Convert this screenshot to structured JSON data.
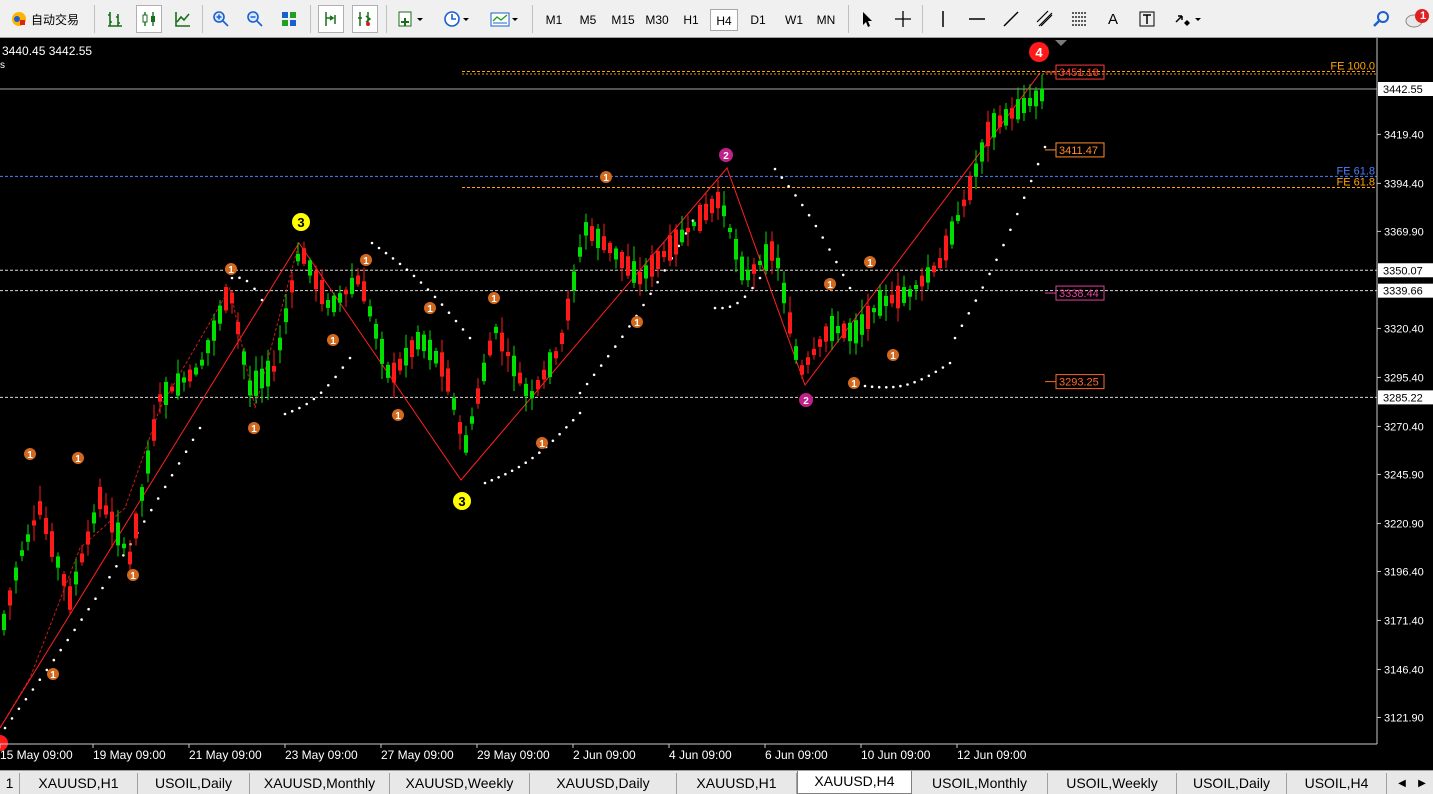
{
  "toolbar": {
    "autotrade_label": "自动交易",
    "timeframes": [
      "M1",
      "M5",
      "M15",
      "M30",
      "H1",
      "H4",
      "D1",
      "W1",
      "MN"
    ],
    "selected_timeframe": "H4",
    "notification_count": "1"
  },
  "chart": {
    "ohlc_readout": "3440.45 3442.55",
    "price_ticks": [
      "3419.40",
      "3394.40",
      "3369.90",
      "3320.40",
      "3295.40",
      "3270.40",
      "3245.90",
      "3220.90",
      "3196.40",
      "3171.40",
      "3146.40",
      "3121.90"
    ],
    "price_levels": [
      {
        "label": "3442.55",
        "price": 3442.55,
        "color": "#c0c0c0",
        "style": "solid"
      },
      {
        "label": "3350.07",
        "price": 3350.07,
        "color": "#ffffff",
        "style": "dashed"
      },
      {
        "label": "3339.66",
        "price": 3339.66,
        "color": "#ffffff",
        "style": "dashed"
      },
      {
        "label": "3285.22",
        "price": 3285.22,
        "color": "#ffffff",
        "style": "dashed"
      }
    ],
    "fib_levels": [
      {
        "label": "FE 100.0",
        "price": 3451.5,
        "color": "#ffa500"
      },
      {
        "label": "FE 61.8",
        "price": 3398.0,
        "color": "#4d7dff"
      },
      {
        "label": "FE 61.8",
        "price": 3392.3,
        "color": "#ffa500"
      }
    ],
    "target_boxes": [
      {
        "label": "3451.18",
        "price": 3451.18,
        "color": "#ff3b3b"
      },
      {
        "label": "3411.47",
        "price": 3411.47,
        "color": "#ff8c2a"
      },
      {
        "label": "3338.44",
        "price": 3338.44,
        "color": "#e0409a"
      },
      {
        "label": "3293.25",
        "price": 3293.25,
        "color": "#ff6a2a"
      }
    ],
    "time_ticks": [
      "15 May 09:00",
      "19 May 09:00",
      "21 May 09:00",
      "23 May 09:00",
      "27 May 09:00",
      "29 May 09:00",
      "2 Jun 09:00",
      "4 Jun 09:00",
      "6 Jun 09:00",
      "10 Jun 09:00",
      "12 Jun 09:00"
    ],
    "wave_labels": [
      {
        "text": "3",
        "kind": "yellow"
      },
      {
        "text": "3",
        "kind": "yellow"
      },
      {
        "text": "2",
        "kind": "magenta"
      },
      {
        "text": "2",
        "kind": "magenta"
      },
      {
        "text": "4",
        "kind": "red"
      },
      {
        "text": "1",
        "kind": "orange"
      }
    ]
  },
  "tabs": [
    "XAUUSD,H1",
    "USOIL,Daily",
    "XAUUSD,Monthly",
    "XAUUSD,Weekly",
    "XAUUSD,Daily",
    "XAUUSD,H1",
    "XAUUSD,H4",
    "USOIL,Monthly",
    "USOIL,Weekly",
    "USOIL,Daily",
    "USOIL,H4"
  ],
  "selected_tab": "XAUUSD,H4",
  "colors": {
    "bull": "#00e000",
    "bear": "#ff1a1a",
    "wave_line": "#ff2020",
    "sar": "#ffffff",
    "background": "#000000"
  }
}
